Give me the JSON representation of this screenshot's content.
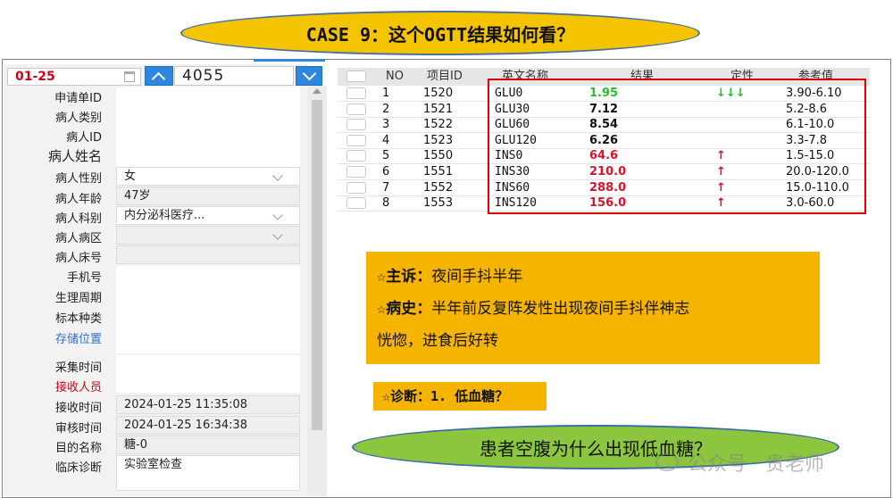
{
  "title": "CASE 9：这个OGTT结果如何看？",
  "left_panel": {
    "date": "01-25",
    "number": "4055",
    "labels": {
      "apply_id": "申请单ID",
      "patient_type": "病人类别",
      "patient_id": "病人ID",
      "patient_name": "病人姓名",
      "patient_sex": "病人性别",
      "patient_age": "病人年龄",
      "patient_dept": "病人科别",
      "patient_ward": "病人病区",
      "patient_bed": "病人床号",
      "phone": "手机号",
      "menstrual": "生理周期",
      "specimen_type": "标本种类",
      "storage": "存储位置",
      "collect_time": "采集时间",
      "receiver": "接收人员",
      "receive_time": "接收时间",
      "audit_time": "审核时间",
      "purpose": "目的名称",
      "clinical_diag": "临床诊断"
    },
    "values": {
      "patient_sex": "女",
      "patient_age": "47岁",
      "patient_dept": "内分泌科医疗...",
      "receive_time": "2024-01-25 11:35:08",
      "audit_time": "2024-01-25 16:34:38",
      "purpose": "糖-0",
      "clinical_diag": "实验室检查"
    }
  },
  "table": {
    "headers": [
      "NO",
      "项目ID",
      "英文名称",
      "结果",
      "定性",
      "参考值"
    ],
    "rows": [
      {
        "no": "1",
        "id": "1520",
        "en": "GLU0",
        "result": "1.95",
        "flag": "↓↓↓",
        "ref": "3.90-6.10",
        "status": "low"
      },
      {
        "no": "2",
        "id": "1521",
        "en": "GLU30",
        "result": "7.12",
        "flag": "",
        "ref": "5.2-8.6",
        "status": "normal"
      },
      {
        "no": "3",
        "id": "1522",
        "en": "GLU60",
        "result": "8.54",
        "flag": "",
        "ref": "6.1-10.0",
        "status": "normal"
      },
      {
        "no": "4",
        "id": "1523",
        "en": "GLU120",
        "result": "6.26",
        "flag": "",
        "ref": "3.3-7.8",
        "status": "normal"
      },
      {
        "no": "5",
        "id": "1550",
        "en": "INS0",
        "result": "64.6",
        "flag": "↑",
        "ref": "1.5-15.0",
        "status": "high"
      },
      {
        "no": "6",
        "id": "1551",
        "en": "INS30",
        "result": "210.0",
        "flag": "↑",
        "ref": "20.0-120.0",
        "status": "high"
      },
      {
        "no": "7",
        "id": "1552",
        "en": "INS60",
        "result": "288.0",
        "flag": "↑",
        "ref": "15.0-110.0",
        "status": "high"
      },
      {
        "no": "8",
        "id": "1553",
        "en": "INS120",
        "result": "156.0",
        "flag": "↑",
        "ref": "3.0-60.0",
        "status": "high"
      }
    ]
  },
  "case_info": {
    "complaint_label": "☆主诉：",
    "complaint": "夜间手抖半年",
    "history_label": "☆病史：",
    "history_line1": "半年前反复阵发性出现夜间手抖伴神志",
    "history_line2": "恍惚，进食后好转",
    "diagnosis": "☆诊断：1. 低血糖？"
  },
  "question": "患者空腹为什么出现低血糖？",
  "watermark": "公众号 · 贵老师",
  "colors": {
    "low": "#22c02a",
    "high": "#e0102a",
    "normal": "#111111",
    "accent": "#2e86de",
    "orange": "#f5b400",
    "green": "#8cc63f"
  }
}
